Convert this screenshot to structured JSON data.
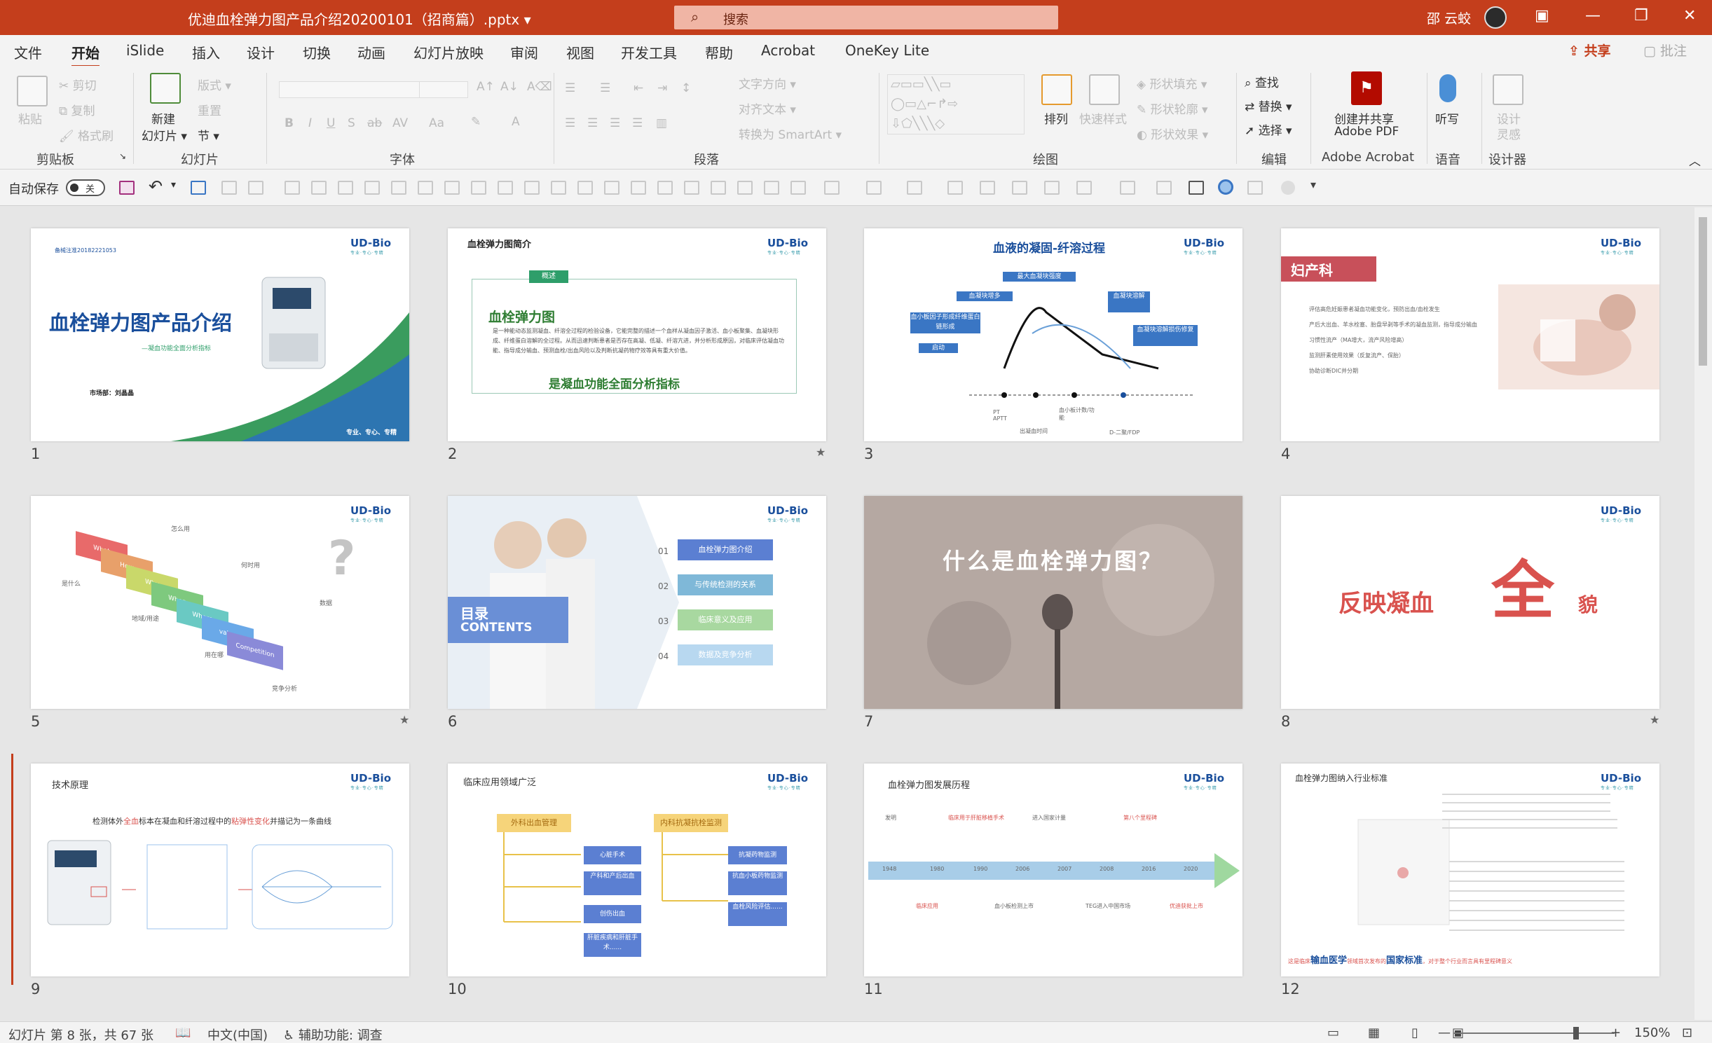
{
  "titlebar": {
    "doc_title": "优迪血栓弹力图产品介绍20200101（招商篇）.pptx ▾",
    "search_placeholder": "搜索",
    "user_name": "邵 云蛟",
    "minimize": "—",
    "restore": "❐",
    "close": "✕",
    "ribbon_display": "▣"
  },
  "tabs": [
    "文件",
    "开始",
    "iSlide",
    "插入",
    "设计",
    "切换",
    "动画",
    "幻灯片放映",
    "审阅",
    "视图",
    "开发工具",
    "帮助",
    "Acrobat",
    "OneKey Lite"
  ],
  "active_tab": "开始",
  "share": "共享",
  "comment": "批注",
  "ribbon": {
    "clipboard": {
      "label": "剪贴板",
      "paste": "粘贴",
      "cut": "剪切",
      "copy": "复制",
      "format_painter": "格式刷"
    },
    "slides": {
      "label": "幻灯片",
      "new_slide": "新建",
      "new_slide2": "幻灯片 ▾",
      "layout": "版式 ▾",
      "reset": "重置",
      "section": "节 ▾"
    },
    "font": {
      "label": "字体"
    },
    "paragraph": {
      "label": "段落",
      "text_direction": "文字方向 ▾",
      "align_text": "对齐文本 ▾",
      "smartart": "转换为 SmartArt ▾"
    },
    "drawing": {
      "label": "绘图",
      "arrange": "排列",
      "quick_styles": "快速样式",
      "fill": "形状填充 ▾",
      "outline": "形状轮廓 ▾",
      "effects": "形状效果 ▾"
    },
    "editing": {
      "label": "编辑",
      "find": "查找",
      "replace": "替换 ▾",
      "select": "选择 ▾"
    },
    "acrobat": {
      "label": "Adobe Acrobat",
      "create_pdf1": "创建并共享",
      "create_pdf2": "Adobe PDF"
    },
    "voice": {
      "label": "语音",
      "dictate": "听写"
    },
    "designer": {
      "label": "设计器",
      "design_ideas1": "设计",
      "design_ideas2": "灵感"
    }
  },
  "qat": {
    "autosave": "自动保存",
    "toggle": "关"
  },
  "slides": [
    {
      "num": "1",
      "title": "血栓弹力图产品介绍",
      "subtitle": "—凝血功能全面分析指标",
      "presenter": "市场部：刘晶晶",
      "code": "备械注准20182221053",
      "footer": "专业、专心、专精"
    },
    {
      "num": "2",
      "title": "血栓弹力图简介",
      "badge": "概述",
      "heading": "血栓弹力图",
      "tagline": "是凝血功能全面分析指标",
      "body": "是一种能动态监测凝血、纤溶全过程的检验设备，它能完整的描述一个血样从凝血因子激活、血小板聚集、血凝块形成、纤维蛋白溶解的全过程。从而迅速判断患者是否存在高凝、低凝、纤溶亢进，并分析形成原因，对临床评估凝血功能、指导成分输血、预测血栓/出血风险以及判断抗凝药物疗效等具有重大价值。"
    },
    {
      "num": "3",
      "title": "血液的凝固-纤溶过程",
      "labels": [
        "最大血凝块强度",
        "血凝块增多",
        "血凝块溶解",
        "血小板因子形成纤维蛋白链形成",
        "血凝块溶解损伤修复",
        "启动"
      ],
      "axis": [
        "PT APTT",
        "出凝血时间",
        "血小板计数/功能",
        "D-二聚/FDP"
      ]
    },
    {
      "num": "4",
      "title": "妇产科",
      "bullets": [
        "评估高危妊娠患者凝血功能变化，预防出血/血栓发生",
        "产后大出血、羊水栓塞、胎盘早剥等手术的凝血监测，指导成分输血",
        "习惯性流产（MA增大，流产风险增高）",
        "监测肝素使用效果（反复流产、保胎）",
        "协助诊断DIC并分期"
      ]
    },
    {
      "num": "5",
      "labels": [
        "What",
        "How",
        "Why",
        "When",
        "Where",
        "value",
        "Competition"
      ],
      "notes": [
        "怎么用",
        "是什么",
        "何时用",
        "地域/用途",
        "用在哪",
        "竞争分析",
        "数据"
      ]
    },
    {
      "num": "6",
      "menu_title": "目录",
      "menu_sub": "CONTENTS",
      "items": [
        {
          "n": "01",
          "t": "血栓弹力图介绍"
        },
        {
          "n": "02",
          "t": "与传统检测的关系"
        },
        {
          "n": "03",
          "t": "临床意义及应用"
        },
        {
          "n": "04",
          "t": "数据及竞争分析"
        }
      ]
    },
    {
      "num": "7",
      "question": "什么是血栓弹力图？"
    },
    {
      "num": "8",
      "text_a": "反映凝血",
      "text_big": "全",
      "text_b": "貌"
    },
    {
      "num": "9",
      "title": "技术原理",
      "desc_a": "检测体外",
      "desc_hl": "全血",
      "desc_b": "标本在凝血和纤溶过程中的",
      "desc_hl2": "粘弹性变化",
      "desc_c": "并描记为一条曲线"
    },
    {
      "num": "10",
      "title": "临床应用领域广泛",
      "col_a": "外科出血管理",
      "col_b": "内科抗凝抗栓监测",
      "items_a": [
        "心脏手术",
        "产科和产后出血",
        "创伤出血",
        "肝脏疾病和肝脏手术......"
      ],
      "items_b": [
        "抗凝药物监测",
        "抗血小板药物监测",
        "血栓风险评估......"
      ]
    },
    {
      "num": "11",
      "title": "血栓弹力图发展历程",
      "years": [
        "1948",
        "1980",
        "1990",
        "2006",
        "2007",
        "2008",
        "2016",
        "2020"
      ],
      "events_top": [
        "发明",
        "临床用于肝脏移植手术",
        "进入国家计量",
        "第八个里程碑"
      ],
      "events_bottom": [
        "临床应用",
        "血小板检测上市",
        "TEG进入中国市场",
        "优迪获批上市"
      ]
    },
    {
      "num": "12",
      "title": "血栓弹力图纳入行业标准",
      "banner_a": "这是临床",
      "banner_hl": "输血医学",
      "banner_b": "领域首次发布的",
      "banner_hl2": "国家标准",
      "banner_c": "，对于整个行业而言具有里程碑意义"
    }
  ],
  "logo_text": "UD-Bio",
  "logo_sub": "专业·专心·专精",
  "status": {
    "slide_info": "幻灯片 第 8 张，共 67 张",
    "language": "中文(中国)",
    "accessibility": "辅助功能: 调查",
    "zoom": "150%",
    "zoom_level": 0.76
  }
}
